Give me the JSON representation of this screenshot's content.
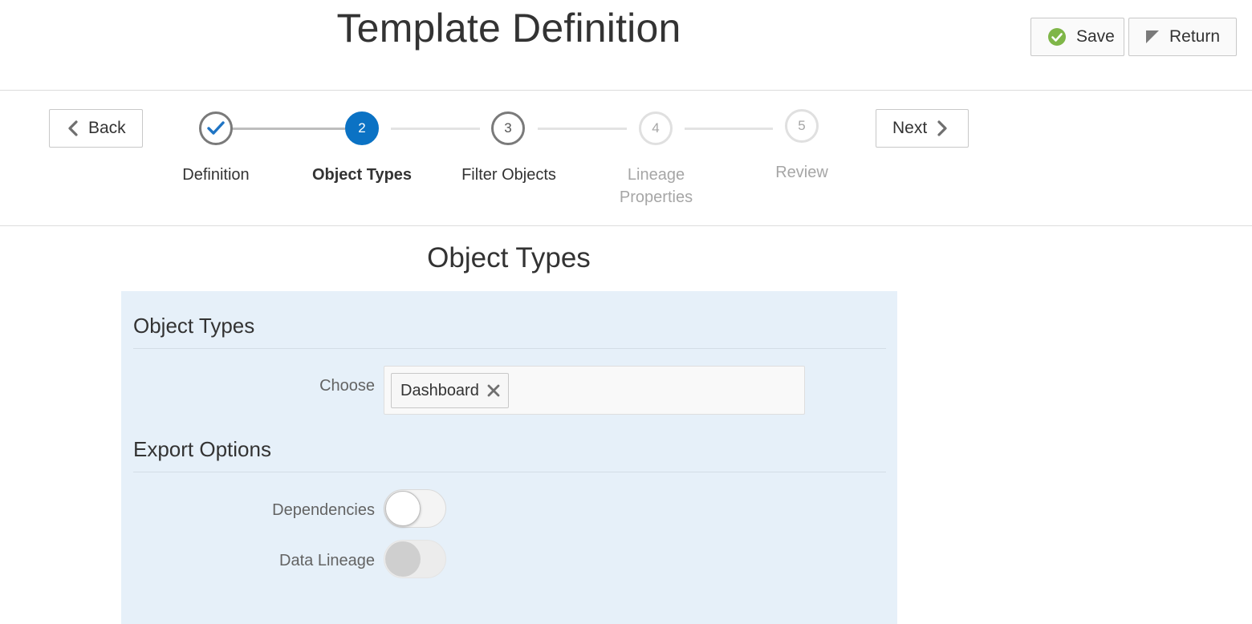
{
  "header": {
    "title": "Template Definition",
    "save_label": "Save",
    "return_label": "Return",
    "save_icon": "check-circle-icon",
    "return_icon": "return-flag-icon"
  },
  "train": {
    "back_label": "Back",
    "next_label": "Next",
    "steps": [
      {
        "number": "",
        "label": "Definition",
        "state": "completed"
      },
      {
        "number": "2",
        "label": "Object Types",
        "state": "current"
      },
      {
        "number": "3",
        "label": "Filter Objects",
        "state": "available"
      },
      {
        "number": "4",
        "label": "Lineage Properties",
        "state": "disabled"
      },
      {
        "number": "5",
        "label": "Review",
        "state": "disabled"
      }
    ]
  },
  "main": {
    "title": "Object Types",
    "object_types": {
      "heading": "Object Types",
      "choose_label": "Choose",
      "selected": [
        "Dashboard"
      ]
    },
    "export_options": {
      "heading": "Export Options",
      "dependencies_label": "Dependencies",
      "dependencies_enabled": true,
      "data_lineage_label": "Data Lineage",
      "data_lineage_enabled": false
    }
  },
  "colors": {
    "accent": "#0b72c4",
    "completed_check": "#1f74c4",
    "save_icon": "#7fb648",
    "panel_bg": "#e6f0f9",
    "disabled_text": "#a6a6a6"
  }
}
